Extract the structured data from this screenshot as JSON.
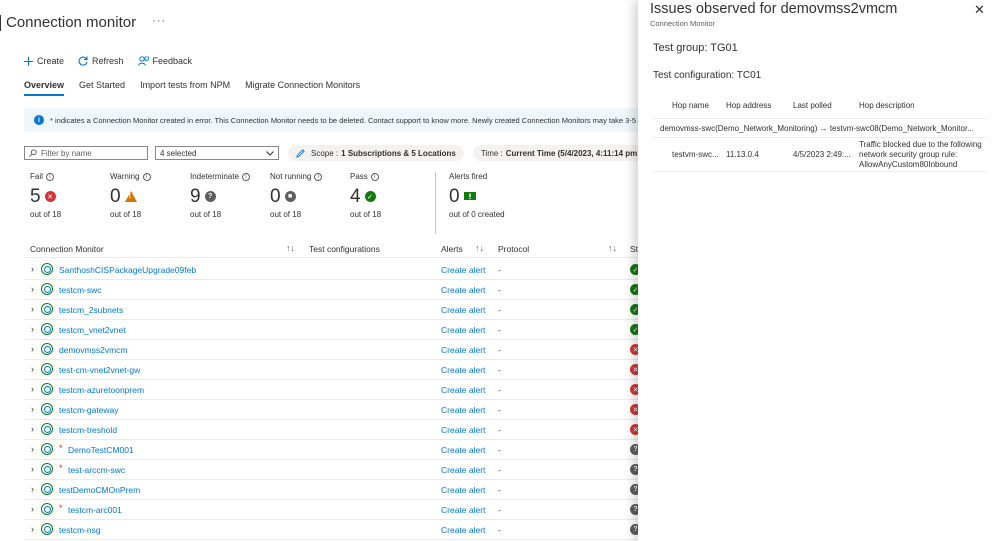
{
  "page": {
    "title": "Connection monitor",
    "more_icon": "ellipsis-icon",
    "toolbar": {
      "create": "Create",
      "refresh": "Refresh",
      "feedback": "Feedback"
    },
    "tabs": [
      {
        "label": "Overview",
        "active": true
      },
      {
        "label": "Get Started",
        "active": false
      },
      {
        "label": "Import tests from NPM",
        "active": false
      },
      {
        "label": "Migrate Connection Monitors",
        "active": false
      }
    ],
    "info_text": "* indicates a Connection Monitor created in error. This Connection Monitor needs to be deleted. Contact support to know more. Newly created Connection Monitors may take 3-5",
    "filter": {
      "placeholder": "Filter by name",
      "selected": "4 selected",
      "scope_label": "Scope :",
      "scope_value": "1 Subscriptions & 5 Locations",
      "time_label": "Time :",
      "time_value": "Current Time (5/4/2023, 4:11:14 pm"
    },
    "stats": [
      {
        "label": "Fail",
        "value": "5",
        "sub": "out of 18",
        "status": "fail"
      },
      {
        "label": "Warning",
        "value": "0",
        "sub": "out of 18",
        "status": "warning"
      },
      {
        "label": "Indeterminate",
        "value": "9",
        "sub": "out of 18",
        "status": "indeterminate"
      },
      {
        "label": "Not running",
        "value": "0",
        "sub": "out of 18",
        "status": "notrunning"
      },
      {
        "label": "Pass",
        "value": "4",
        "sub": "out of 18",
        "status": "pass"
      }
    ],
    "alerts_fired": {
      "label": "Alerts fired",
      "value": "0",
      "sub": "out of 0 created"
    },
    "columns": {
      "name": "Connection Monitor",
      "tests": "Test configurations",
      "alerts": "Alerts",
      "protocol": "Protocol",
      "status_short": "St"
    },
    "rows": [
      {
        "name": "SanthoshCISPackageUpgrade09feb",
        "error": false,
        "alert": "Create alert",
        "protocol": "-",
        "status": "pass"
      },
      {
        "name": "testcm-swc",
        "error": false,
        "alert": "Create alert",
        "protocol": "-",
        "status": "pass"
      },
      {
        "name": "testcm_2subnets",
        "error": false,
        "alert": "Create alert",
        "protocol": "-",
        "status": "pass"
      },
      {
        "name": "testcm_vnet2vnet",
        "error": false,
        "alert": "Create alert",
        "protocol": "-",
        "status": "pass"
      },
      {
        "name": "demovmss2vmcm",
        "error": false,
        "alert": "Create alert",
        "protocol": "-",
        "status": "fail"
      },
      {
        "name": "test-cm-vnet2vnet-gw",
        "error": false,
        "alert": "Create alert",
        "protocol": "-",
        "status": "fail"
      },
      {
        "name": "testcm-azuretoonprem",
        "error": false,
        "alert": "Create alert",
        "protocol": "-",
        "status": "fail"
      },
      {
        "name": "testcm-gateway",
        "error": false,
        "alert": "Create alert",
        "protocol": "-",
        "status": "fail"
      },
      {
        "name": "testcm-treshold",
        "error": false,
        "alert": "Create alert",
        "protocol": "-",
        "status": "fail"
      },
      {
        "name": "DemoTestCM001",
        "error": true,
        "alert": "Create alert",
        "protocol": "-",
        "status": "indeterminate"
      },
      {
        "name": "test-arccm-swc",
        "error": true,
        "alert": "Create alert",
        "protocol": "-",
        "status": "indeterminate"
      },
      {
        "name": "testDemoCMOnPrem",
        "error": false,
        "alert": "Create alert",
        "protocol": "-",
        "status": "indeterminate"
      },
      {
        "name": "testcm-arc001",
        "error": true,
        "alert": "Create alert",
        "protocol": "-",
        "status": "indeterminate"
      },
      {
        "name": "testcm-nsg",
        "error": false,
        "alert": "Create alert",
        "protocol": "-",
        "status": "indeterminate"
      }
    ]
  },
  "panel": {
    "title": "Issues observed for demovmss2vmcm",
    "subtitle": "Connection Monitor",
    "test_group": "Test group: TG01",
    "test_config": "Test configuration: TC01",
    "hop_headers": {
      "name": "Hop name",
      "address": "Hop address",
      "polled": "Last polled",
      "desc": "Hop description"
    },
    "path": "demovmss-swc(Demo_Network_Monitoring) → testvm-swc08(Demo_Network_Monitor...",
    "hop": {
      "name": "testvm-swc...",
      "address": "11.13.0.4",
      "polled": "4/5/2023 2:49:...",
      "desc": "Traffic blocked due to the following network security group rule: AllowAnyCustom80Inbound"
    }
  },
  "colors": {
    "accent": "#0078d4",
    "fail": "#d13438",
    "pass": "#107c10",
    "warning": "#d47500",
    "neutral": "#605e5c"
  }
}
